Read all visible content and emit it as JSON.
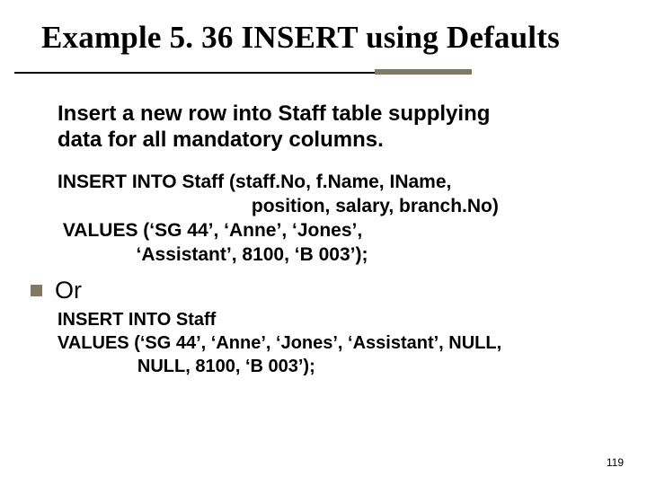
{
  "title": "Example 5. 36  INSERT using Defaults",
  "intro_line1": "Insert a new row into Staff table supplying",
  "intro_line2": "data for all mandatory columns.",
  "sql1_line1": "INSERT INTO Staff (staff.No, f.Name, IName,",
  "sql1_line2": "                                     position, salary, branch.No)",
  "sql1_line3": " VALUES (‘SG 44’, ‘Anne’, ‘Jones’,",
  "sql1_line4": "               ‘Assistant’, 8100, ‘B 003’);",
  "or_label": "Or",
  "sql2_line1": "INSERT INTO Staff",
  "sql2_line2": "VALUES (‘SG 44’, ‘Anne’, ‘Jones’, ‘Assistant’, NULL,",
  "sql2_line3": "                NULL, 8100, ‘B 003’);",
  "page_number": "119"
}
